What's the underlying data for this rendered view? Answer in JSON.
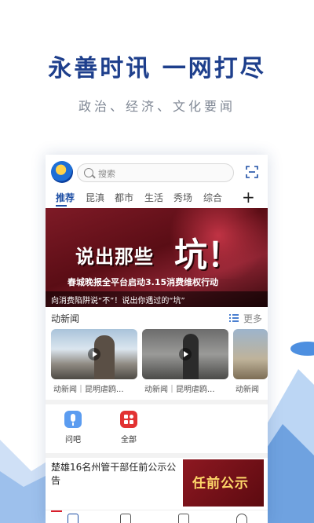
{
  "promo": {
    "headline": "永善时讯 一网打尽",
    "subline": "政治、经济、文化要闻"
  },
  "app": {
    "search": {
      "placeholder": "搜索",
      "icon": "search-icon"
    },
    "scan_icon": "scan-icon",
    "tabs": [
      {
        "label": "推荐",
        "active": true
      },
      {
        "label": "昆滇"
      },
      {
        "label": "都市"
      },
      {
        "label": "生活"
      },
      {
        "label": "秀场"
      },
      {
        "label": "综合"
      }
    ],
    "tab_add_label": "+",
    "banner": {
      "title": "说出那些",
      "big_char": "坑！",
      "subtitle": "春城晚报全平台启动3.15消费维权行动",
      "caption": "向消费陷阱说“不”！说出你遇过的“坑”"
    },
    "news_section": {
      "title": "动新闻",
      "more_label": "更多"
    },
    "videos": [
      {
        "caption": "动新闻｜昆明虐鸥..."
      },
      {
        "caption": "动新闻｜昆明虐鸥..."
      },
      {
        "caption": "动新闻"
      }
    ],
    "shortcuts": [
      {
        "label": "问吧",
        "icon": "microphone-icon",
        "color": "#4a90e2"
      },
      {
        "label": "全部",
        "icon": "grid-icon",
        "color": "#e23232"
      }
    ],
    "article": {
      "title": "楚雄16名州管干部任前公示公告",
      "thumb_text": "任前公示"
    }
  },
  "colors": {
    "brand_blue": "#1e3f8c",
    "active_tab": "#1e4fa5",
    "banner_red": "#7e1a26"
  }
}
